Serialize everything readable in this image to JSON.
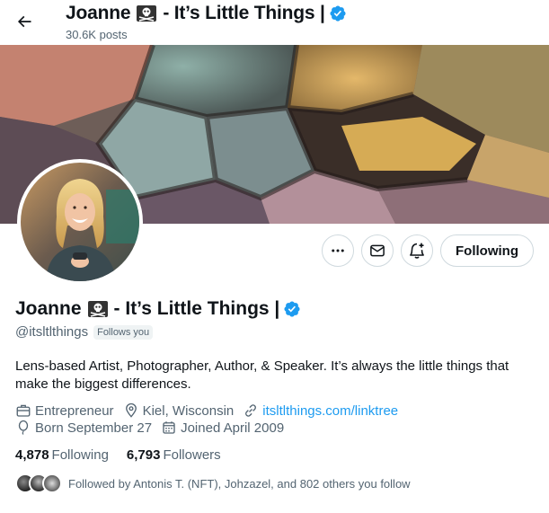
{
  "header": {
    "title_text": "Joanne",
    "title_rest": "- It’s Little Things |",
    "posts": "30.6K posts"
  },
  "profile": {
    "name_text": "Joanne",
    "name_rest": "- It’s Little Things |",
    "handle": "@itsltlthings",
    "follows_you": "Follows you",
    "bio": "Lens-based Artist, Photographer, Author, & Speaker. It’s always the little things that make the biggest differences.",
    "occupation": "Entrepreneur",
    "location": "Kiel, Wisconsin",
    "website": "itsltlthings.com/linktree",
    "born": "Born September 27",
    "joined": "Joined April 2009",
    "following_count": "4,878",
    "following_label": "Following",
    "followers_count": "6,793",
    "followers_label": "Followers",
    "followed_by": "Followed by Antonis T. (NFT), Johzazel, and 802 others you follow"
  },
  "actions": {
    "following_button": "Following"
  },
  "icons": {
    "back": "back-arrow-icon",
    "more": "more-icon",
    "message": "envelope-icon",
    "notify": "bell-plus-icon",
    "verified": "verified-badge-icon",
    "skull": "skull-crossbones-icon"
  },
  "colors": {
    "accent": "#1d9bf0",
    "text": "#0f1419",
    "muted": "#536471",
    "border": "#cfd9de"
  }
}
